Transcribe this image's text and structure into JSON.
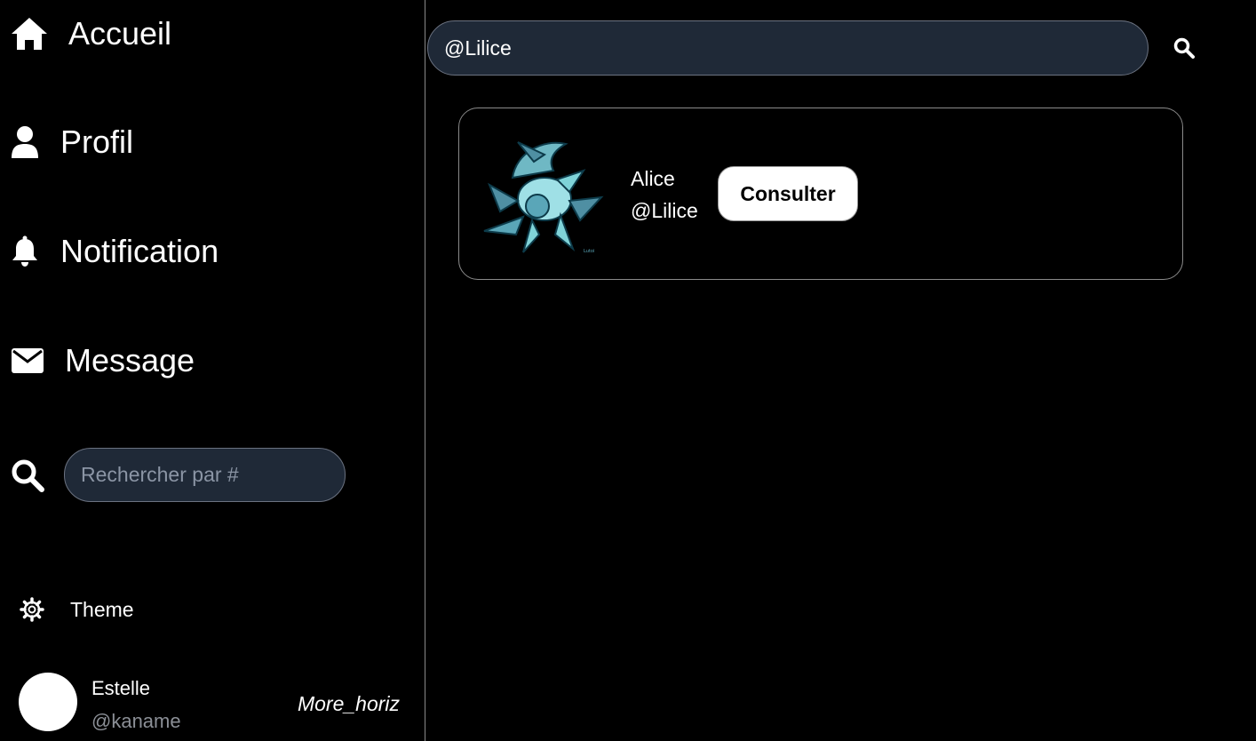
{
  "sidebar": {
    "nav": [
      {
        "label": "Accueil",
        "icon": "home-icon"
      },
      {
        "label": "Profil",
        "icon": "user-icon"
      },
      {
        "label": "Notification",
        "icon": "bell-icon"
      },
      {
        "label": "Message",
        "icon": "envelope-icon"
      }
    ],
    "search": {
      "placeholder": "Rechercher par #",
      "value": "",
      "icon": "search-icon"
    },
    "theme": {
      "label": "Theme",
      "icon": "gear-icon"
    },
    "user": {
      "name": "Estelle",
      "handle": "@kaname",
      "more_label": "More_horiz"
    }
  },
  "main": {
    "search": {
      "value": "@Lilice",
      "icon": "search-icon"
    },
    "results": [
      {
        "name": "Alice",
        "handle": "@Lilice",
        "button_label": "Consulter",
        "avatar": "glaceon-avatar"
      }
    ]
  },
  "colors": {
    "background": "#000000",
    "input_bg": "#1f2937",
    "border": "#8a8a8a",
    "muted_text": "#8b8f96",
    "avatar_teal": "#7fd3d8"
  }
}
